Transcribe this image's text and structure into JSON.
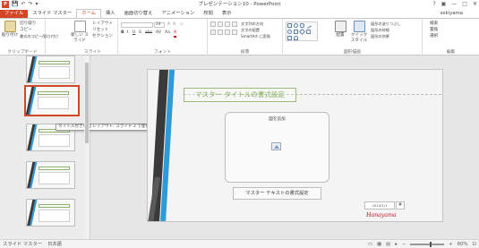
{
  "window": {
    "title": "プレゼンテーション10 - PowerPoint",
    "app_icon": "P",
    "minimize": "—",
    "maximize": "□",
    "close": "✕",
    "help": "?",
    "ribbon_display": "▣"
  },
  "qat": {
    "save": "💾",
    "undo": "↶",
    "redo": "↷",
    "customize": "▾"
  },
  "tabs": [
    {
      "label": "ファイル"
    },
    {
      "label": "スライド マスター"
    },
    {
      "label": "ホーム"
    },
    {
      "label": "挿入"
    },
    {
      "label": "画面切り替え"
    },
    {
      "label": "アニメーション"
    },
    {
      "label": "校閲"
    },
    {
      "label": "表示"
    }
  ],
  "user_name": "sekiyama",
  "ribbon": {
    "clipboard": {
      "label": "クリップボード",
      "paste": "貼り付け",
      "cut": "切り取り",
      "copy": "コピー",
      "format_painter": "書式のコピー/貼り付け"
    },
    "slides": {
      "label": "スライド",
      "new_slide": "新しい スライド",
      "layout": "レイアウト",
      "reset": "リセット",
      "section": "セクション"
    },
    "font": {
      "label": "フォント",
      "font_name": "",
      "font_size": "24",
      "bold": "B",
      "italic": "I",
      "underline": "U",
      "shadow": "S",
      "strike": "abc",
      "spacing": "AV",
      "case": "Aa",
      "color": "A"
    },
    "paragraph": {
      "label": "段落",
      "text_direction": "文字列の方向",
      "align_text": "文字の配置",
      "smartart": "SmartArt に変換"
    },
    "drawing": {
      "label": "図形描画",
      "arrange": "配置",
      "quick_styles": "クイック スタイル",
      "fill": "図形の塗りつぶし",
      "outline": "図形の枠線",
      "effects": "図形の効果"
    },
    "editing": {
      "label": "編集",
      "find": "検索",
      "replace": "置換",
      "select": "選択"
    }
  },
  "thumbnails": {
    "tooltip": "タイトル付きの図 レイアウト: スライド 2 で使用される"
  },
  "slide": {
    "title_placeholder": "マスター タイトルの書式設定",
    "content_placeholder": "図を追加",
    "text_placeholder": "マスター テキストの書式設定",
    "date_placeholder": "2014/1/1",
    "page_number": "#",
    "signature": "Hanayama"
  },
  "status": {
    "view": "スライド マスター",
    "language": "日本語",
    "zoom": "60%",
    "zoom_minus": "−",
    "zoom_plus": "+"
  },
  "colors": {
    "accent": "#d24726",
    "title_green": "#7eab53",
    "stripe_blue": "#2f9ad8",
    "stripe_dark": "#3a3a3a"
  }
}
